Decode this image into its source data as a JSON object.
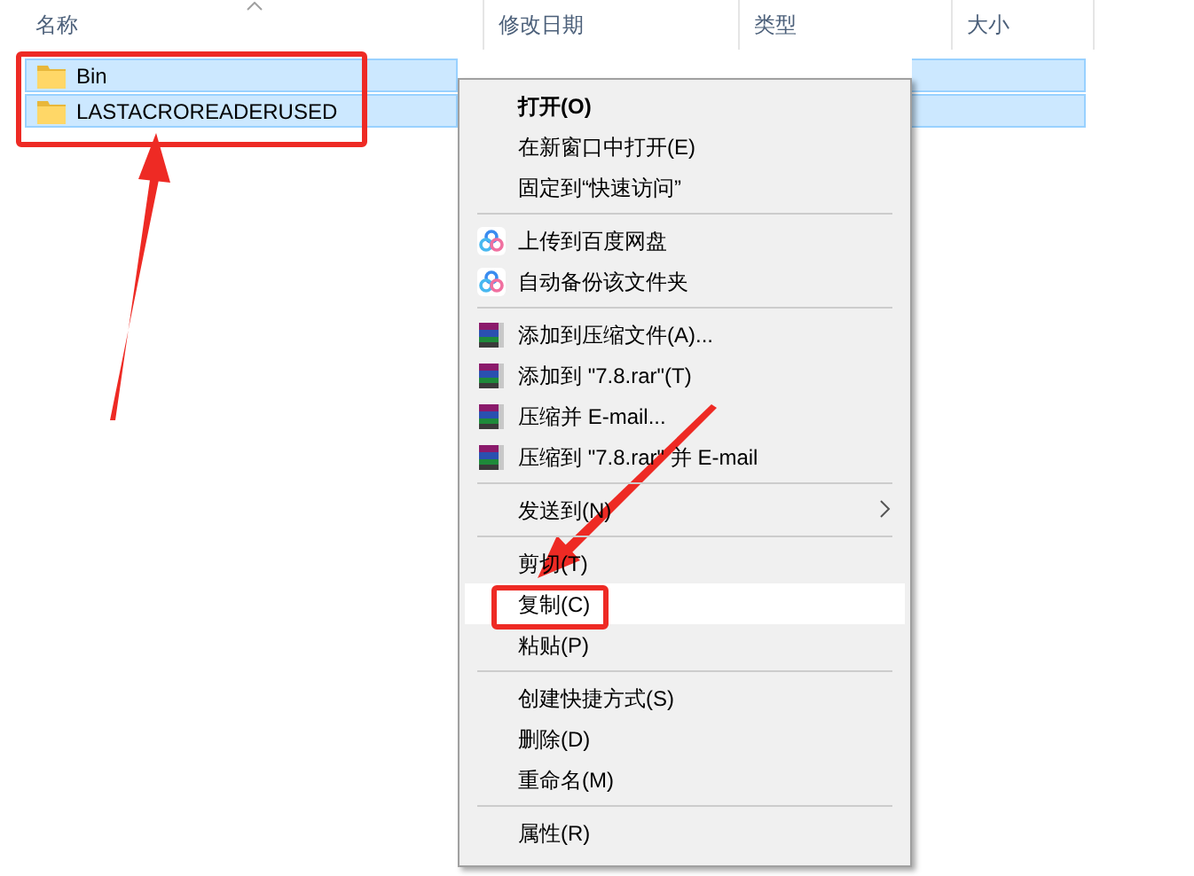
{
  "columns": [
    {
      "label": "名称",
      "sorted": true
    },
    {
      "label": "修改日期"
    },
    {
      "label": "类型"
    },
    {
      "label": "大小"
    }
  ],
  "files": [
    {
      "name": "Bin",
      "selected": true
    },
    {
      "name": "LASTACROREADERUSED",
      "selected": true
    }
  ],
  "context_menu": [
    {
      "kind": "item",
      "label": "打开(O)",
      "default": true,
      "selected": false
    },
    {
      "kind": "item",
      "label": "在新窗口中打开(E)",
      "default": false,
      "selected": false
    },
    {
      "kind": "item",
      "label": "固定到“快速访问”",
      "default": false,
      "selected": false
    },
    {
      "kind": "separator"
    },
    {
      "kind": "cloud",
      "label": "上传到百度网盘",
      "default": false,
      "selected": false
    },
    {
      "kind": "cloud",
      "label": "自动备份该文件夹",
      "default": false,
      "selected": false
    },
    {
      "kind": "separator"
    },
    {
      "kind": "archive",
      "label": "添加到压缩文件(A)...",
      "default": false,
      "selected": false
    },
    {
      "kind": "archive",
      "label": "添加到 \"7.8.rar\"(T)",
      "default": false,
      "selected": false
    },
    {
      "kind": "archive",
      "label": "压缩并 E-mail...",
      "default": false,
      "selected": false
    },
    {
      "kind": "archive",
      "label": "压缩到 \"7.8.rar\" 并 E-mail",
      "default": false,
      "selected": false
    },
    {
      "kind": "separator"
    },
    {
      "kind": "item",
      "label": "发送到(N)",
      "submenu": true,
      "default": false,
      "selected": false
    },
    {
      "kind": "separator"
    },
    {
      "kind": "item",
      "label": "剪切(T)",
      "default": false,
      "selected": false
    },
    {
      "kind": "item",
      "label": "复制(C)",
      "default": false,
      "selected": true
    },
    {
      "kind": "item",
      "label": "粘贴(P)",
      "default": false,
      "selected": false
    },
    {
      "kind": "separator"
    },
    {
      "kind": "item",
      "label": "创建快捷方式(S)",
      "default": false,
      "selected": false
    },
    {
      "kind": "item",
      "label": "删除(D)",
      "default": false,
      "selected": false
    },
    {
      "kind": "item",
      "label": "重命名(M)",
      "default": false,
      "selected": false
    },
    {
      "kind": "separator"
    },
    {
      "kind": "item",
      "label": "属性(R)",
      "default": false,
      "selected": false
    }
  ]
}
